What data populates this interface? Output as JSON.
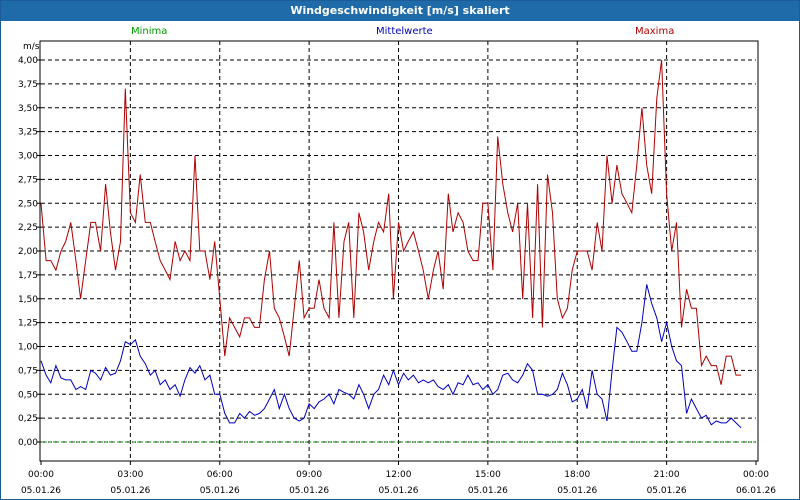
{
  "window": {
    "title": "Windgeschwindigkeit [m/s] skaliert"
  },
  "legend": [
    {
      "name": "Minima",
      "color": "#00a000"
    },
    {
      "name": "Mittelwerte",
      "color": "#0000c0"
    },
    {
      "name": "Maxima",
      "color": "#b00000"
    }
  ],
  "chart_data": {
    "type": "line",
    "ylabel": "m/s",
    "ylim": [
      0,
      4.0
    ],
    "ytick_step": 0.25,
    "xlim": [
      0,
      24
    ],
    "grid": true,
    "x_tick_labels": [
      {
        "time": "00:00",
        "date": "05.01.26"
      },
      {
        "time": "03:00",
        "date": "05.01.26"
      },
      {
        "time": "06:00",
        "date": "05.01.26"
      },
      {
        "time": "09:00",
        "date": "05.01.26"
      },
      {
        "time": "12:00",
        "date": "05.01.26"
      },
      {
        "time": "15:00",
        "date": "05.01.26"
      },
      {
        "time": "18:00",
        "date": "05.01.26"
      },
      {
        "time": "21:00",
        "date": "05.01.26"
      },
      {
        "time": "00:00",
        "date": "06.01.26"
      }
    ],
    "series": [
      {
        "name": "Minima",
        "color": "#00a000",
        "points": [
          [
            0,
            0.0
          ],
          [
            24,
            0.0
          ]
        ]
      },
      {
        "name": "Mittelwerte",
        "color": "#0000c0",
        "points": [
          [
            0.0,
            0.85
          ],
          [
            0.17,
            0.7
          ],
          [
            0.33,
            0.62
          ],
          [
            0.5,
            0.8
          ],
          [
            0.67,
            0.67
          ],
          [
            0.83,
            0.65
          ],
          [
            1.0,
            0.65
          ],
          [
            1.17,
            0.55
          ],
          [
            1.33,
            0.58
          ],
          [
            1.5,
            0.55
          ],
          [
            1.67,
            0.75
          ],
          [
            1.83,
            0.72
          ],
          [
            2.0,
            0.65
          ],
          [
            2.17,
            0.78
          ],
          [
            2.33,
            0.7
          ],
          [
            2.5,
            0.72
          ],
          [
            2.67,
            0.85
          ],
          [
            2.83,
            1.05
          ],
          [
            3.0,
            1.02
          ],
          [
            3.17,
            1.07
          ],
          [
            3.33,
            0.9
          ],
          [
            3.5,
            0.82
          ],
          [
            3.67,
            0.7
          ],
          [
            3.83,
            0.75
          ],
          [
            4.0,
            0.6
          ],
          [
            4.17,
            0.65
          ],
          [
            4.33,
            0.55
          ],
          [
            4.5,
            0.6
          ],
          [
            4.67,
            0.48
          ],
          [
            4.83,
            0.65
          ],
          [
            5.0,
            0.78
          ],
          [
            5.17,
            0.72
          ],
          [
            5.33,
            0.8
          ],
          [
            5.5,
            0.65
          ],
          [
            5.67,
            0.7
          ],
          [
            5.83,
            0.5
          ],
          [
            6.0,
            0.5
          ],
          [
            6.17,
            0.3
          ],
          [
            6.33,
            0.2
          ],
          [
            6.5,
            0.2
          ],
          [
            6.67,
            0.3
          ],
          [
            6.83,
            0.25
          ],
          [
            7.0,
            0.32
          ],
          [
            7.17,
            0.28
          ],
          [
            7.33,
            0.3
          ],
          [
            7.5,
            0.35
          ],
          [
            7.67,
            0.45
          ],
          [
            7.83,
            0.55
          ],
          [
            8.0,
            0.35
          ],
          [
            8.17,
            0.5
          ],
          [
            8.33,
            0.35
          ],
          [
            8.5,
            0.25
          ],
          [
            8.67,
            0.22
          ],
          [
            8.83,
            0.25
          ],
          [
            9.0,
            0.4
          ],
          [
            9.17,
            0.35
          ],
          [
            9.33,
            0.42
          ],
          [
            9.5,
            0.45
          ],
          [
            9.67,
            0.5
          ],
          [
            9.83,
            0.4
          ],
          [
            10.0,
            0.55
          ],
          [
            10.17,
            0.52
          ],
          [
            10.33,
            0.5
          ],
          [
            10.5,
            0.45
          ],
          [
            10.67,
            0.6
          ],
          [
            10.83,
            0.5
          ],
          [
            11.0,
            0.35
          ],
          [
            11.17,
            0.5
          ],
          [
            11.33,
            0.55
          ],
          [
            11.5,
            0.7
          ],
          [
            11.67,
            0.6
          ],
          [
            11.83,
            0.75
          ],
          [
            12.0,
            0.6
          ],
          [
            12.17,
            0.72
          ],
          [
            12.33,
            0.65
          ],
          [
            12.5,
            0.7
          ],
          [
            12.67,
            0.62
          ],
          [
            12.83,
            0.65
          ],
          [
            13.0,
            0.62
          ],
          [
            13.17,
            0.65
          ],
          [
            13.33,
            0.58
          ],
          [
            13.5,
            0.55
          ],
          [
            13.67,
            0.6
          ],
          [
            13.83,
            0.5
          ],
          [
            14.0,
            0.62
          ],
          [
            14.17,
            0.6
          ],
          [
            14.33,
            0.7
          ],
          [
            14.5,
            0.6
          ],
          [
            14.67,
            0.62
          ],
          [
            14.83,
            0.55
          ],
          [
            15.0,
            0.6
          ],
          [
            15.17,
            0.5
          ],
          [
            15.33,
            0.55
          ],
          [
            15.5,
            0.7
          ],
          [
            15.67,
            0.72
          ],
          [
            15.83,
            0.65
          ],
          [
            16.0,
            0.62
          ],
          [
            16.17,
            0.7
          ],
          [
            16.33,
            0.82
          ],
          [
            16.5,
            0.75
          ],
          [
            16.67,
            0.5
          ],
          [
            16.83,
            0.5
          ],
          [
            17.0,
            0.48
          ],
          [
            17.17,
            0.5
          ],
          [
            17.33,
            0.55
          ],
          [
            17.5,
            0.72
          ],
          [
            17.67,
            0.6
          ],
          [
            17.83,
            0.42
          ],
          [
            18.0,
            0.45
          ],
          [
            18.17,
            0.55
          ],
          [
            18.33,
            0.35
          ],
          [
            18.5,
            0.75
          ],
          [
            18.67,
            0.5
          ],
          [
            18.83,
            0.45
          ],
          [
            19.0,
            0.22
          ],
          [
            19.17,
            0.75
          ],
          [
            19.33,
            1.2
          ],
          [
            19.5,
            1.15
          ],
          [
            19.67,
            1.05
          ],
          [
            19.83,
            0.95
          ],
          [
            20.0,
            0.95
          ],
          [
            20.17,
            1.25
          ],
          [
            20.33,
            1.65
          ],
          [
            20.5,
            1.45
          ],
          [
            20.67,
            1.3
          ],
          [
            20.83,
            1.05
          ],
          [
            21.0,
            1.25
          ],
          [
            21.17,
            1.0
          ],
          [
            21.33,
            0.85
          ],
          [
            21.5,
            0.8
          ],
          [
            21.67,
            0.3
          ],
          [
            21.83,
            0.45
          ],
          [
            22.0,
            0.35
          ],
          [
            22.17,
            0.25
          ],
          [
            22.33,
            0.28
          ],
          [
            22.5,
            0.18
          ],
          [
            22.67,
            0.22
          ],
          [
            22.83,
            0.2
          ],
          [
            23.0,
            0.2
          ],
          [
            23.17,
            0.25
          ],
          [
            23.33,
            0.2
          ],
          [
            23.5,
            0.15
          ]
        ]
      },
      {
        "name": "Maxima",
        "color": "#b00000",
        "points": [
          [
            0.0,
            2.5
          ],
          [
            0.17,
            1.9
          ],
          [
            0.33,
            1.9
          ],
          [
            0.5,
            1.8
          ],
          [
            0.67,
            2.0
          ],
          [
            0.83,
            2.1
          ],
          [
            1.0,
            2.3
          ],
          [
            1.17,
            1.9
          ],
          [
            1.33,
            1.5
          ],
          [
            1.5,
            1.9
          ],
          [
            1.67,
            2.3
          ],
          [
            1.83,
            2.3
          ],
          [
            2.0,
            2.0
          ],
          [
            2.17,
            2.7
          ],
          [
            2.33,
            2.2
          ],
          [
            2.5,
            1.8
          ],
          [
            2.67,
            2.1
          ],
          [
            2.83,
            3.7
          ],
          [
            3.0,
            2.4
          ],
          [
            3.17,
            2.3
          ],
          [
            3.33,
            2.8
          ],
          [
            3.5,
            2.3
          ],
          [
            3.67,
            2.3
          ],
          [
            3.83,
            2.1
          ],
          [
            4.0,
            1.9
          ],
          [
            4.17,
            1.8
          ],
          [
            4.33,
            1.7
          ],
          [
            4.5,
            2.1
          ],
          [
            4.67,
            1.9
          ],
          [
            4.83,
            2.0
          ],
          [
            5.0,
            1.9
          ],
          [
            5.17,
            3.0
          ],
          [
            5.33,
            2.0
          ],
          [
            5.5,
            2.0
          ],
          [
            5.67,
            1.7
          ],
          [
            5.83,
            2.1
          ],
          [
            6.0,
            1.5
          ],
          [
            6.17,
            0.9
          ],
          [
            6.33,
            1.3
          ],
          [
            6.5,
            1.2
          ],
          [
            6.67,
            1.1
          ],
          [
            6.83,
            1.3
          ],
          [
            7.0,
            1.3
          ],
          [
            7.17,
            1.2
          ],
          [
            7.33,
            1.2
          ],
          [
            7.5,
            1.7
          ],
          [
            7.67,
            2.0
          ],
          [
            7.83,
            1.4
          ],
          [
            8.0,
            1.3
          ],
          [
            8.17,
            1.1
          ],
          [
            8.33,
            0.9
          ],
          [
            8.5,
            1.4
          ],
          [
            8.67,
            1.9
          ],
          [
            8.83,
            1.3
          ],
          [
            9.0,
            1.4
          ],
          [
            9.17,
            1.4
          ],
          [
            9.33,
            1.7
          ],
          [
            9.5,
            1.4
          ],
          [
            9.67,
            1.3
          ],
          [
            9.83,
            2.3
          ],
          [
            10.0,
            1.3
          ],
          [
            10.17,
            2.1
          ],
          [
            10.33,
            2.3
          ],
          [
            10.5,
            1.3
          ],
          [
            10.67,
            2.4
          ],
          [
            10.83,
            2.2
          ],
          [
            11.0,
            1.8
          ],
          [
            11.17,
            2.1
          ],
          [
            11.33,
            2.3
          ],
          [
            11.5,
            2.2
          ],
          [
            11.67,
            2.6
          ],
          [
            11.83,
            1.5
          ],
          [
            12.0,
            2.3
          ],
          [
            12.17,
            2.0
          ],
          [
            12.33,
            2.1
          ],
          [
            12.5,
            2.2
          ],
          [
            12.67,
            2.0
          ],
          [
            12.83,
            1.8
          ],
          [
            13.0,
            1.5
          ],
          [
            13.17,
            1.8
          ],
          [
            13.33,
            2.0
          ],
          [
            13.5,
            1.6
          ],
          [
            13.67,
            2.6
          ],
          [
            13.83,
            2.2
          ],
          [
            14.0,
            2.4
          ],
          [
            14.17,
            2.3
          ],
          [
            14.33,
            2.0
          ],
          [
            14.5,
            1.9
          ],
          [
            14.67,
            1.9
          ],
          [
            14.83,
            2.5
          ],
          [
            15.0,
            2.5
          ],
          [
            15.17,
            1.8
          ],
          [
            15.33,
            3.2
          ],
          [
            15.5,
            2.7
          ],
          [
            15.67,
            2.4
          ],
          [
            15.83,
            2.2
          ],
          [
            16.0,
            2.5
          ],
          [
            16.17,
            1.5
          ],
          [
            16.33,
            2.5
          ],
          [
            16.5,
            1.3
          ],
          [
            16.67,
            2.7
          ],
          [
            16.83,
            1.2
          ],
          [
            17.0,
            2.8
          ],
          [
            17.17,
            2.4
          ],
          [
            17.33,
            1.5
          ],
          [
            17.5,
            1.3
          ],
          [
            17.67,
            1.4
          ],
          [
            17.83,
            1.8
          ],
          [
            18.0,
            2.0
          ],
          [
            18.17,
            2.0
          ],
          [
            18.33,
            2.0
          ],
          [
            18.5,
            1.8
          ],
          [
            18.67,
            2.3
          ],
          [
            18.83,
            2.0
          ],
          [
            19.0,
            3.0
          ],
          [
            19.17,
            2.5
          ],
          [
            19.33,
            2.9
          ],
          [
            19.5,
            2.6
          ],
          [
            19.67,
            2.5
          ],
          [
            19.83,
            2.4
          ],
          [
            20.0,
            2.9
          ],
          [
            20.17,
            3.5
          ],
          [
            20.33,
            2.9
          ],
          [
            20.5,
            2.6
          ],
          [
            20.67,
            3.6
          ],
          [
            20.83,
            4.0
          ],
          [
            21.0,
            2.6
          ],
          [
            21.17,
            2.0
          ],
          [
            21.33,
            2.3
          ],
          [
            21.5,
            1.2
          ],
          [
            21.67,
            1.6
          ],
          [
            21.83,
            1.4
          ],
          [
            22.0,
            1.4
          ],
          [
            22.17,
            0.8
          ],
          [
            22.33,
            0.9
          ],
          [
            22.5,
            0.8
          ],
          [
            22.67,
            0.8
          ],
          [
            22.83,
            0.6
          ],
          [
            23.0,
            0.9
          ],
          [
            23.17,
            0.9
          ],
          [
            23.33,
            0.7
          ],
          [
            23.5,
            0.7
          ]
        ]
      }
    ]
  }
}
